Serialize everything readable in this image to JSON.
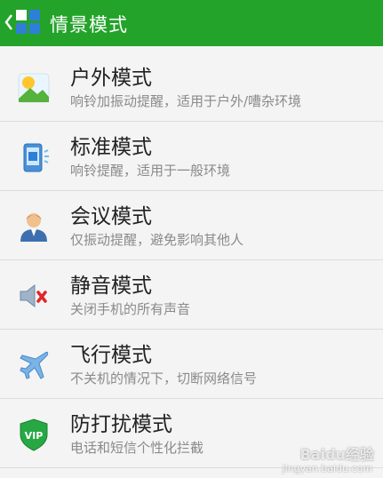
{
  "header": {
    "title": "情景模式"
  },
  "items": [
    {
      "title": "户外模式",
      "desc": "响铃加振动提醒，适用于户外/嘈杂环境",
      "icon": "sun-landscape-icon"
    },
    {
      "title": "标准模式",
      "desc": "响铃提醒，适用于一般环境",
      "icon": "phone-ring-icon"
    },
    {
      "title": "会议模式",
      "desc": "仅振动提醒，避免影响其他人",
      "icon": "meeting-person-icon"
    },
    {
      "title": "静音模式",
      "desc": "关闭手机的所有声音",
      "icon": "speaker-mute-icon"
    },
    {
      "title": "飞行模式",
      "desc": "不关机的情况下，切断网络信号",
      "icon": "airplane-icon"
    },
    {
      "title": "防打扰模式",
      "desc": "电话和短信个性化拦截",
      "icon": "vip-shield-icon"
    }
  ],
  "watermark": {
    "main": "Baidu经验",
    "sub": "jingyan.baidu.com"
  }
}
